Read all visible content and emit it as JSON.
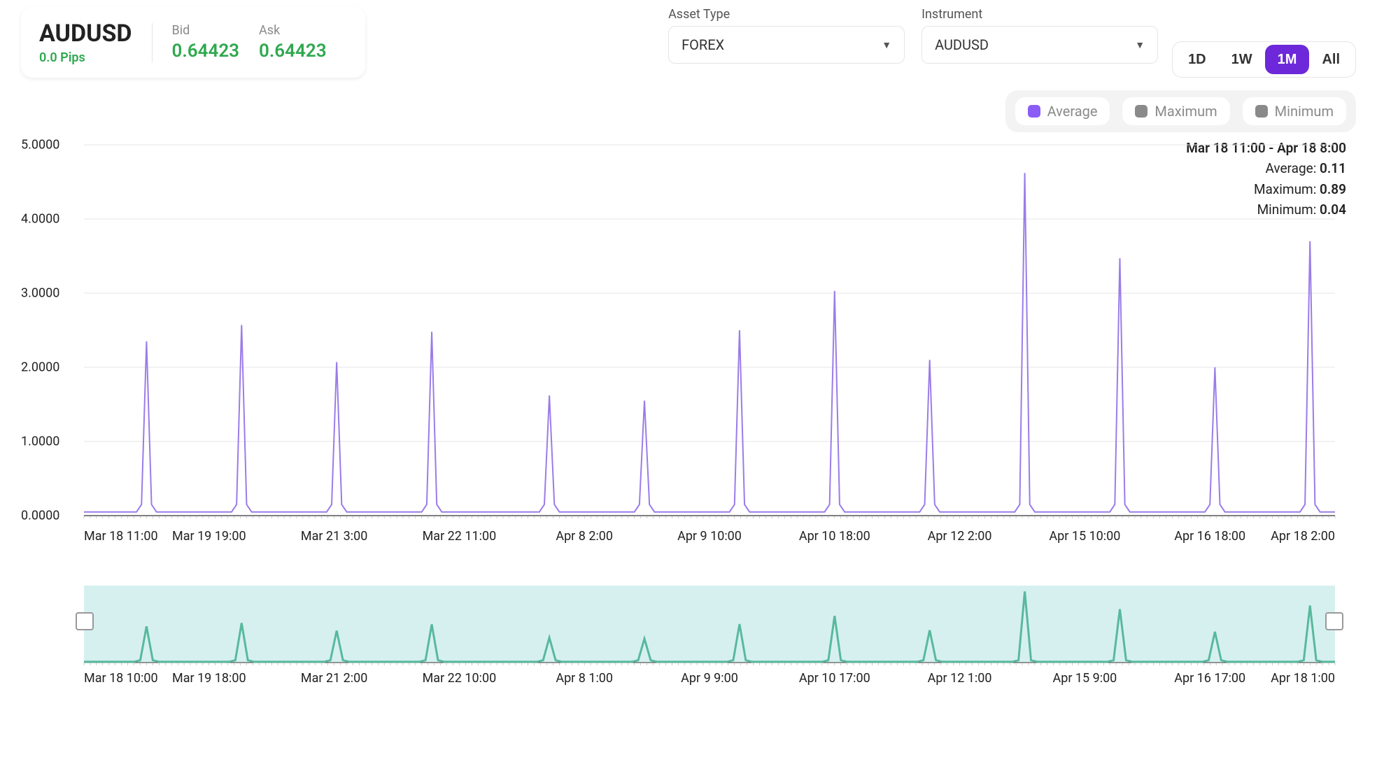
{
  "quote": {
    "symbol": "AUDUSD",
    "pips": "0.0 Pips",
    "bid_label": "Bid",
    "bid": "0.64423",
    "ask_label": "Ask",
    "ask": "0.64423"
  },
  "selects": {
    "asset_type_label": "Asset Type",
    "asset_type_value": "FOREX",
    "instrument_label": "Instrument",
    "instrument_value": "AUDUSD"
  },
  "timeframes": {
    "d": "1D",
    "w": "1W",
    "m": "1M",
    "all": "All",
    "active": "1M"
  },
  "legend": {
    "avg": "Average",
    "max": "Maximum",
    "min": "Minimum",
    "active": "Average"
  },
  "info": {
    "range": "Mar 18 11:00 - Apr 18 8:00",
    "avg_label": "Average:",
    "avg_val": "0.11",
    "max_label": "Maximum:",
    "max_val": "0.89",
    "min_label": "Minimum:",
    "min_val": "0.04"
  },
  "chart_data": {
    "type": "line",
    "title": "",
    "xlabel": "",
    "ylabel": "",
    "ylim": [
      0,
      5
    ],
    "y_ticks": [
      "0.0000",
      "1.0000",
      "2.0000",
      "3.0000",
      "4.0000",
      "5.0000"
    ],
    "main_x_ticks": [
      "Mar 18 11:00",
      "Mar 19 19:00",
      "Mar 21 3:00",
      "Mar 22 11:00",
      "Apr 8 2:00",
      "Apr 9 10:00",
      "Apr 10 18:00",
      "Apr 12 2:00",
      "Apr 15 10:00",
      "Apr 16 18:00",
      "Apr 18 2:00"
    ],
    "range_x_ticks": [
      "Mar 18 10:00",
      "Mar 19 18:00",
      "Mar 21 2:00",
      "Mar 22 10:00",
      "Apr 8 1:00",
      "Apr 9 9:00",
      "Apr 10 17:00",
      "Apr 12 1:00",
      "Apr 15 9:00",
      "Apr 16 17:00",
      "Apr 18 1:00"
    ],
    "series": [
      {
        "name": "Average",
        "spikes": [
          {
            "pos": 0.05,
            "value": 2.35
          },
          {
            "pos": 0.126,
            "value": 2.57
          },
          {
            "pos": 0.202,
            "value": 2.07
          },
          {
            "pos": 0.278,
            "value": 2.48
          },
          {
            "pos": 0.372,
            "value": 1.62
          },
          {
            "pos": 0.448,
            "value": 1.55
          },
          {
            "pos": 0.524,
            "value": 2.5
          },
          {
            "pos": 0.6,
            "value": 3.03
          },
          {
            "pos": 0.676,
            "value": 2.1
          },
          {
            "pos": 0.752,
            "value": 4.62
          },
          {
            "pos": 0.828,
            "value": 3.47
          },
          {
            "pos": 0.904,
            "value": 2.0
          },
          {
            "pos": 0.98,
            "value": 3.7
          }
        ],
        "baseline": 0.05,
        "color": "#9b7ce8"
      }
    ]
  }
}
